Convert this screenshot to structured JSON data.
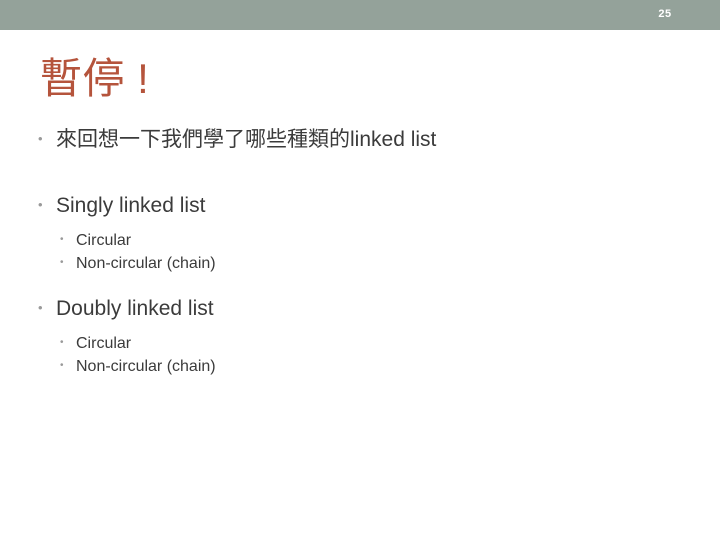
{
  "slide": {
    "number": "25",
    "title": "暫停 !",
    "accent_color": "#b5543c",
    "band_color": "#94a29a",
    "text_color": "#3b3b3b",
    "bullet_marker": "•"
  },
  "content": [
    {
      "level": 1,
      "text": "來回想一下我們學了哪些種類的linked list"
    },
    {
      "level": 1,
      "text": "Singly linked list"
    },
    {
      "level": 2,
      "text": "Circular"
    },
    {
      "level": 2,
      "text": "Non-circular (chain)"
    },
    {
      "level": 1,
      "text": "Doubly linked list"
    },
    {
      "level": 2,
      "text": "Circular"
    },
    {
      "level": 2,
      "text": "Non-circular (chain)"
    }
  ]
}
